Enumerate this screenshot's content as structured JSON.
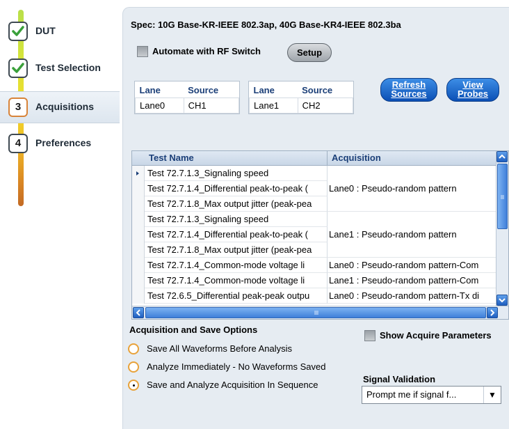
{
  "nav": {
    "steps": [
      {
        "label": "DUT",
        "num": "",
        "done": true
      },
      {
        "label": "Test Selection",
        "num": "",
        "done": true
      },
      {
        "label": "Acquisitions",
        "num": "3",
        "done": false
      },
      {
        "label": "Preferences",
        "num": "4",
        "done": false
      }
    ],
    "active_index": 2
  },
  "spec": "Spec: 10G Base-KR-IEEE 802.3ap, 40G Base-KR4-IEEE 802.3ba",
  "automate": {
    "label": "Automate with RF Switch",
    "checked": false
  },
  "setup_label": "Setup",
  "lane_tables": [
    {
      "headers": [
        "Lane",
        "Source"
      ],
      "row": [
        "Lane0",
        "CH1"
      ]
    },
    {
      "headers": [
        "Lane",
        "Source"
      ],
      "row": [
        "Lane1",
        "CH2"
      ]
    }
  ],
  "refresh_label": [
    "Refresh",
    "Sources"
  ],
  "probes_label": [
    "View",
    "Probes"
  ],
  "grid": {
    "headers": [
      "Test Name",
      "Acquisition"
    ],
    "rows": [
      "Test 72.7.1.3_Signaling speed",
      "Test 72.7.1.4_Differential peak-to-peak (",
      "Test 72.7.1.8_Max output jitter (peak-pea",
      "Test 72.7.1.3_Signaling speed",
      "Test 72.7.1.4_Differential peak-to-peak (",
      "Test 72.7.1.8_Max output jitter (peak-pea",
      "Test 72.7.1.4_Common-mode voltage li",
      "Test 72.7.1.4_Common-mode voltage li",
      "Test 72.6.5_Differential peak-peak outpu"
    ],
    "acquisitions": [
      "Lane0 : Pseudo-random pattern",
      "Lane1 : Pseudo-random pattern",
      "Lane0 : Pseudo-random pattern-Com",
      "Lane1 : Pseudo-random pattern-Com",
      "Lane0 : Pseudo-random pattern-Tx di"
    ]
  },
  "options": {
    "title": "Acquisition and Save Options",
    "items": [
      "Save All Waveforms Before Analysis",
      "Analyze Immediately - No Waveforms Saved",
      "Save and Analyze Acquisition In Sequence"
    ],
    "selected": 2
  },
  "show_acquire": {
    "label": "Show Acquire Parameters",
    "checked": false
  },
  "signal_validation": {
    "title": "Signal Validation",
    "value": "Prompt me if signal f..."
  },
  "colors": {
    "panel": "#e6ecf2",
    "accent_blue": "#1b3f78",
    "radio_orange": "#e8a23a"
  }
}
